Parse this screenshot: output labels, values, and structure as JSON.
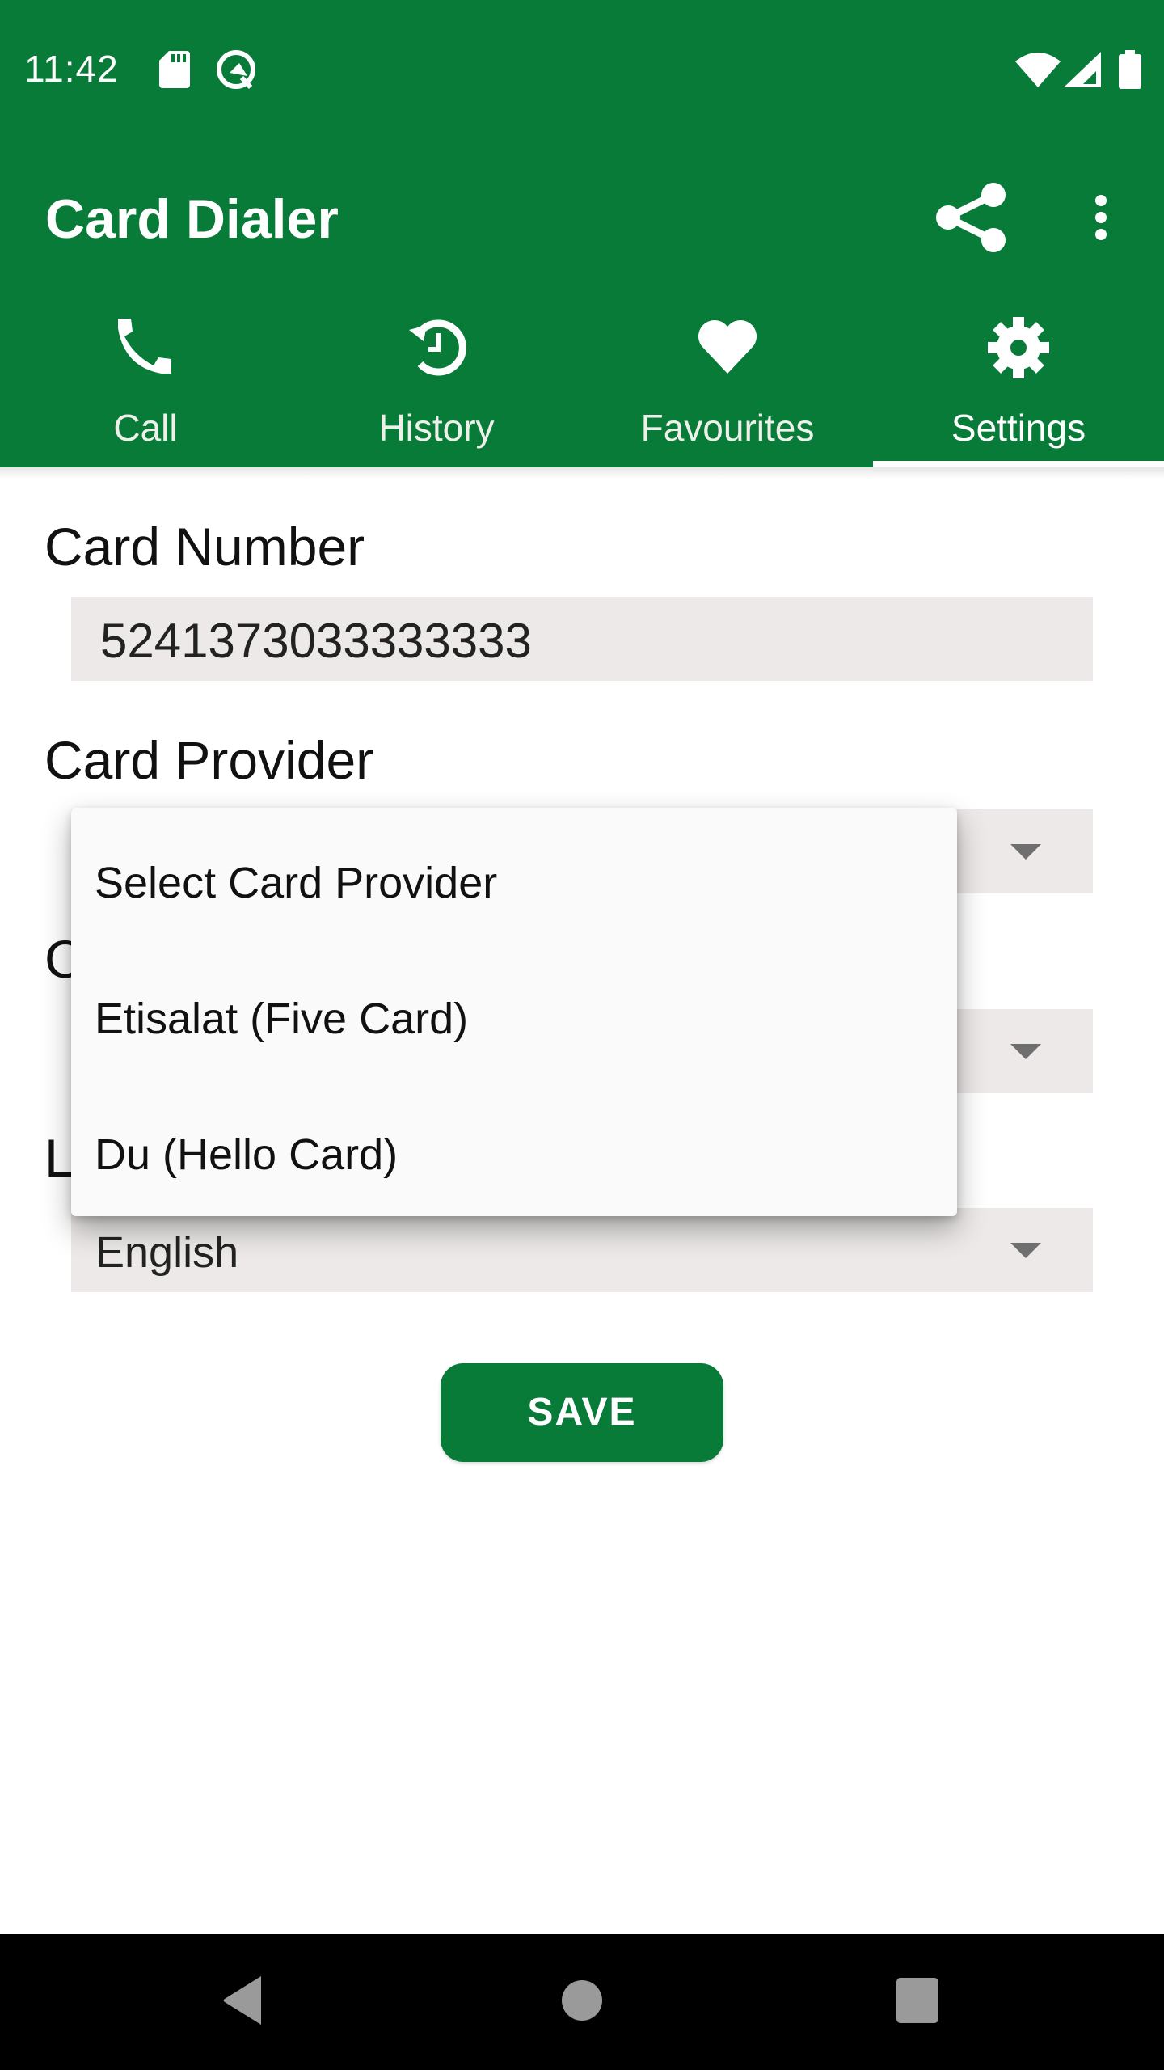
{
  "status_bar": {
    "time": "11:42",
    "left_icons": [
      "sd-card-icon",
      "android-q-icon"
    ],
    "right_icons": [
      "wifi-icon",
      "cell-signal-icon",
      "battery-icon"
    ]
  },
  "app_bar": {
    "title": "Card Dialer",
    "actions": [
      "share-icon",
      "more-vert-icon"
    ],
    "color": "#087B39"
  },
  "tabs": [
    {
      "label": "Call",
      "icon": "phone-icon",
      "selected": false
    },
    {
      "label": "History",
      "icon": "history-icon",
      "selected": false
    },
    {
      "label": "Favourites",
      "icon": "heart-icon",
      "selected": false
    },
    {
      "label": "Settings",
      "icon": "gear-icon",
      "selected": true
    }
  ],
  "form": {
    "card_number_label": "Card Number",
    "card_number_value": "5241373033333333",
    "card_provider_label": "Card Provider",
    "third_label_visible": "C",
    "language_label_visible": "L",
    "language_value": "English",
    "save_label": "SAVE"
  },
  "dropdown": {
    "options": [
      "Select Card Provider",
      "Etisalat (Five Card)",
      "Du (Hello Card)"
    ]
  },
  "nav_bar": {
    "buttons": [
      "back",
      "home",
      "recents"
    ]
  }
}
